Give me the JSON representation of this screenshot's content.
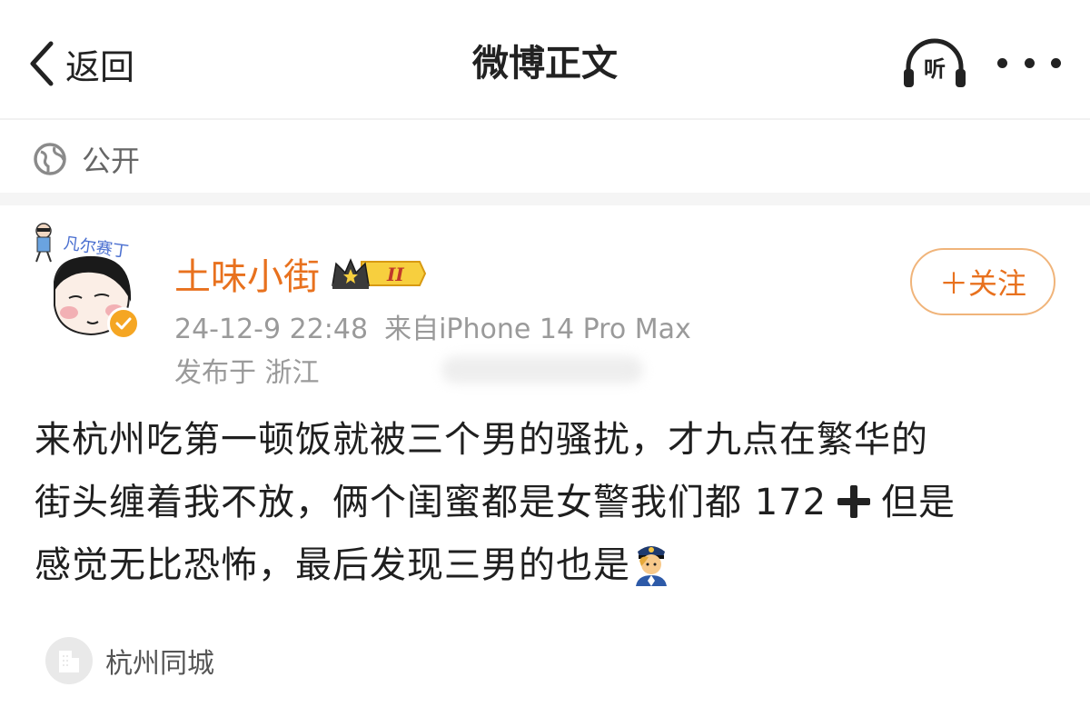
{
  "header": {
    "back_label": "返回",
    "title": "微博正文",
    "listen_label": "听"
  },
  "visibility": {
    "label": "公开"
  },
  "author": {
    "name": "土味小街",
    "badge_level": "II",
    "timestamp": "24-12-9 22:48",
    "source": "来自iPhone 14 Pro Max",
    "location": "发布于 浙江",
    "avatar_caption": "凡尔赛丁"
  },
  "follow_button": {
    "label": "＋关注"
  },
  "post": {
    "line1": "来杭州吃第一顿饭就被三个男的骚扰，才九点在繁华的",
    "line2a": "街头缠着我不放，俩个闺蜜都是女警我们都 172",
    "line2b": "但是",
    "line3": "感觉无比恐怖，最后发现三男的也是"
  },
  "topic": {
    "label": "杭州同城"
  },
  "colors": {
    "accent_orange": "#e8711e",
    "follow_border": "#f0b47a",
    "meta_gray": "#9a9a9a",
    "verified": "#f5a623"
  },
  "icons": {
    "back": "chevron-left-icon",
    "listen": "headphones-icon",
    "more": "more-dots-icon",
    "globe": "globe-icon",
    "verified": "verified-badge-icon",
    "crown": "crown-badge-icon",
    "plus": "heavy-plus-icon",
    "police": "police-officer-emoji",
    "topic": "building-icon"
  }
}
